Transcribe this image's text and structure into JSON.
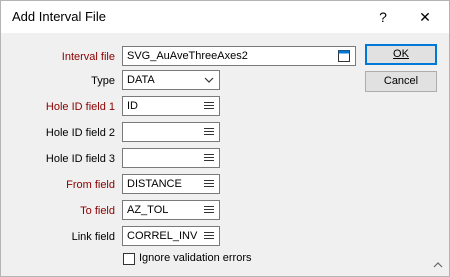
{
  "window": {
    "title": "Add Interval File",
    "help_label": "?",
    "close_label": "✕"
  },
  "fields": {
    "interval_file": {
      "label": "Interval file",
      "value": "SVG_AuAveThreeAxes2"
    },
    "type": {
      "label": "Type",
      "value": "DATA"
    },
    "hole_id_1": {
      "label": "Hole ID field 1",
      "value": "ID"
    },
    "hole_id_2": {
      "label": "Hole ID field 2",
      "value": ""
    },
    "hole_id_3": {
      "label": "Hole ID field 3",
      "value": ""
    },
    "from": {
      "label": "From field",
      "value": "DISTANCE"
    },
    "to": {
      "label": "To field",
      "value": "AZ_TOL"
    },
    "link": {
      "label": "Link field",
      "value": "CORREL_INV"
    }
  },
  "buttons": {
    "ok": "OK",
    "cancel": "Cancel"
  },
  "checkbox": {
    "label": "Ignore validation errors",
    "checked": false
  }
}
